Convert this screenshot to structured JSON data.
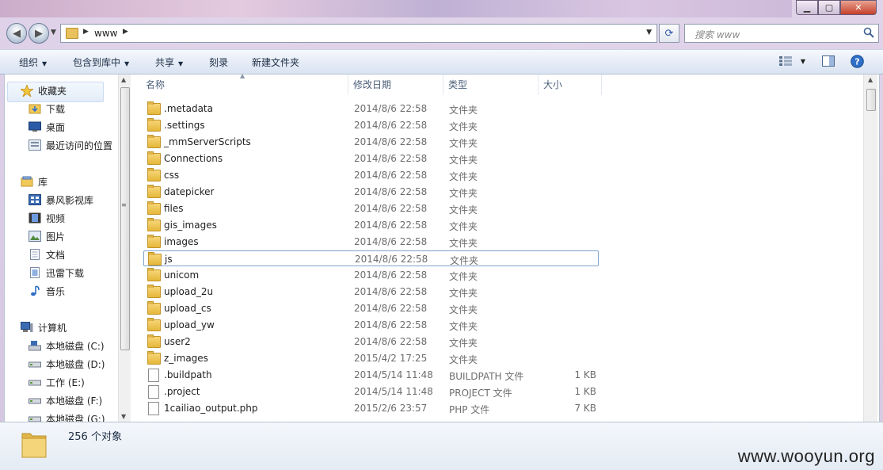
{
  "window": {
    "controls": {
      "minimize": "▁",
      "maximize": "▢",
      "close": "✕"
    }
  },
  "address": {
    "path": "www",
    "search_placeholder": "搜索 www"
  },
  "toolbar": {
    "organize": "组织",
    "include_in_library": "包含到库中",
    "share": "共享",
    "burn": "刻录",
    "new_folder": "新建文件夹"
  },
  "sidebar": {
    "favorites": {
      "label": "收藏夹",
      "items": [
        "下载",
        "桌面",
        "最近访问的位置"
      ]
    },
    "libraries": {
      "label": "库",
      "items": [
        "暴风影视库",
        "视频",
        "图片",
        "文档",
        "迅雷下载",
        "音乐"
      ]
    },
    "computer": {
      "label": "计算机",
      "items": [
        "本地磁盘 (C:)",
        "本地磁盘 (D:)",
        "工作 (E:)",
        "本地磁盘 (F:)",
        "本地磁盘 (G:)"
      ]
    }
  },
  "columns": {
    "name": "名称",
    "date": "修改日期",
    "type": "类型",
    "size": "大小"
  },
  "files": [
    {
      "name": ".metadata",
      "date": "2014/8/6 22:58",
      "type": "文件夹",
      "size": "",
      "icon": "folder-icon"
    },
    {
      "name": ".settings",
      "date": "2014/8/6 22:58",
      "type": "文件夹",
      "size": "",
      "icon": "folder-icon"
    },
    {
      "name": "_mmServerScripts",
      "date": "2014/8/6 22:58",
      "type": "文件夹",
      "size": "",
      "icon": "folder-icon"
    },
    {
      "name": "Connections",
      "date": "2014/8/6 22:58",
      "type": "文件夹",
      "size": "",
      "icon": "folder-icon"
    },
    {
      "name": "css",
      "date": "2014/8/6 22:58",
      "type": "文件夹",
      "size": "",
      "icon": "folder-icon"
    },
    {
      "name": "datepicker",
      "date": "2014/8/6 22:58",
      "type": "文件夹",
      "size": "",
      "icon": "folder-icon"
    },
    {
      "name": "files",
      "date": "2014/8/6 22:58",
      "type": "文件夹",
      "size": "",
      "icon": "folder-icon"
    },
    {
      "name": "gis_images",
      "date": "2014/8/6 22:58",
      "type": "文件夹",
      "size": "",
      "icon": "folder-icon"
    },
    {
      "name": "images",
      "date": "2014/8/6 22:58",
      "type": "文件夹",
      "size": "",
      "icon": "folder-icon"
    },
    {
      "name": "js",
      "date": "2014/8/6 22:58",
      "type": "文件夹",
      "size": "",
      "icon": "folder-icon"
    },
    {
      "name": "unicom",
      "date": "2014/8/6 22:58",
      "type": "文件夹",
      "size": "",
      "icon": "folder-icon"
    },
    {
      "name": "upload_2u",
      "date": "2014/8/6 22:58",
      "type": "文件夹",
      "size": "",
      "icon": "folder-icon"
    },
    {
      "name": "upload_cs",
      "date": "2014/8/6 22:58",
      "type": "文件夹",
      "size": "",
      "icon": "folder-icon"
    },
    {
      "name": "upload_yw",
      "date": "2014/8/6 22:58",
      "type": "文件夹",
      "size": "",
      "icon": "folder-icon"
    },
    {
      "name": "user2",
      "date": "2014/8/6 22:58",
      "type": "文件夹",
      "size": "",
      "icon": "folder-icon"
    },
    {
      "name": "z_images",
      "date": "2015/4/2 17:25",
      "type": "文件夹",
      "size": "",
      "icon": "folder-icon"
    },
    {
      "name": ".buildpath",
      "date": "2014/5/14 11:48",
      "type": "BUILDPATH 文件",
      "size": "1 KB",
      "icon": "file-icon"
    },
    {
      "name": ".project",
      "date": "2014/5/14 11:48",
      "type": "PROJECT 文件",
      "size": "1 KB",
      "icon": "file-icon"
    },
    {
      "name": "1cailiao_output.php",
      "date": "2015/2/6 23:57",
      "type": "PHP 文件",
      "size": "7 KB",
      "icon": "file-icon"
    }
  ],
  "selected_file": "js",
  "status": {
    "count": "256 个对象"
  },
  "watermark": "www.wooyun.org"
}
